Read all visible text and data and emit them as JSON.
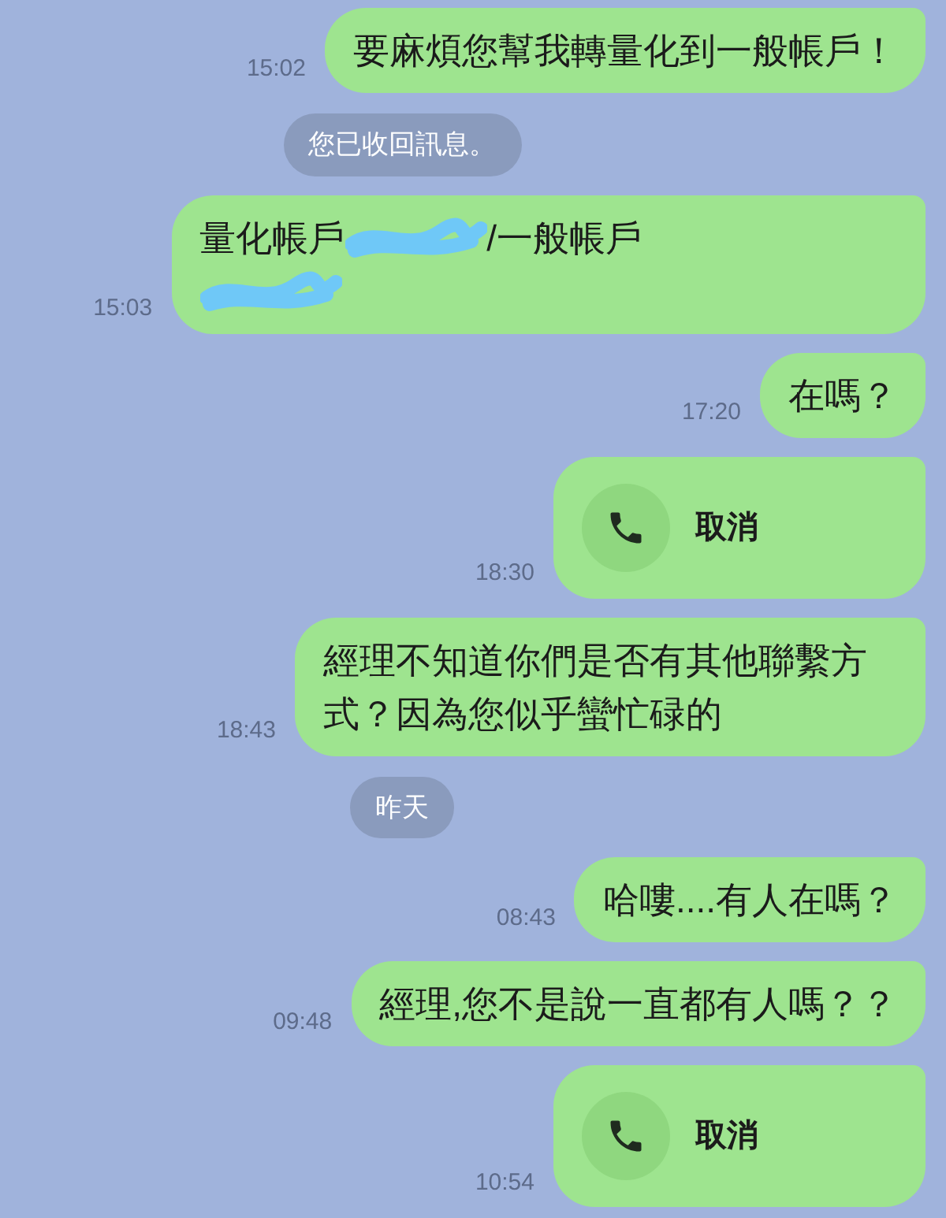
{
  "messages": [
    {
      "kind": "text",
      "text": "要麻煩您幫我轉量化到一般帳戶！",
      "time": "15:02"
    },
    {
      "kind": "notice",
      "text": "您已收回訊息。"
    },
    {
      "kind": "parts",
      "parts": [
        {
          "kind": "text",
          "text": "量化帳戶"
        },
        {
          "kind": "redacted"
        },
        {
          "kind": "text",
          "text": "/一般帳戶"
        },
        {
          "kind": "line_break"
        },
        {
          "kind": "redacted"
        }
      ],
      "time": "15:03"
    },
    {
      "kind": "text",
      "text": "在嗎？",
      "time": "17:20"
    },
    {
      "kind": "call",
      "text": "取消",
      "time": "18:30"
    },
    {
      "kind": "text",
      "text": "經理不知道你們是否有其他聯繫方式？因為您似乎蠻忙碌的",
      "time": "18:43"
    },
    {
      "kind": "notice",
      "text": "昨天"
    },
    {
      "kind": "text",
      "text": "哈嘍....有人在嗎？",
      "time": "08:43"
    },
    {
      "kind": "text",
      "text": "經理,您不是說一直都有人嗎？？",
      "time": "09:48"
    },
    {
      "kind": "call",
      "text": "取消",
      "time": "10:54"
    }
  ]
}
